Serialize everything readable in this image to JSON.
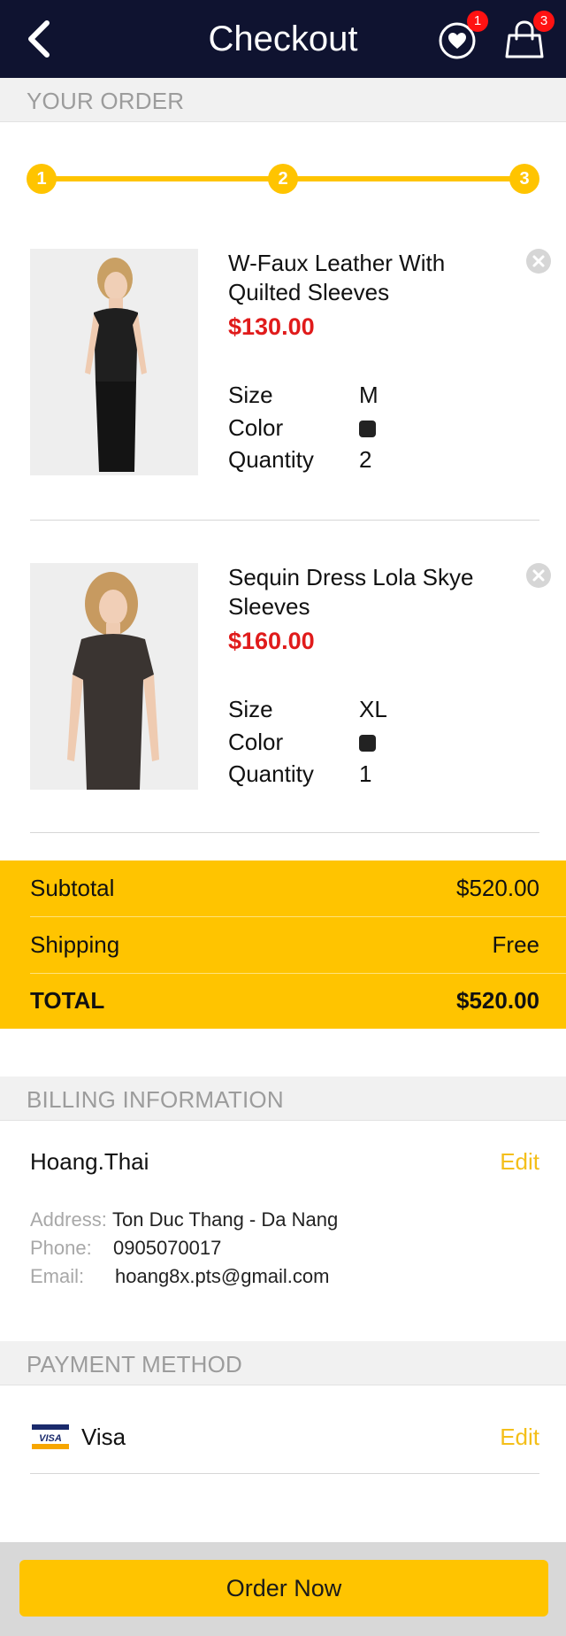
{
  "header": {
    "title": "Checkout",
    "wishlist_count": "1",
    "cart_count": "3"
  },
  "sections": {
    "order": "YOUR ORDER",
    "billing": "BILLING INFORMATION",
    "payment": "PAYMENT METHOD"
  },
  "progress": {
    "steps": [
      "1",
      "2",
      "3"
    ],
    "current_step": 3
  },
  "order_items": [
    {
      "name": "W-Faux Leather With Quilted Sleeves",
      "price": "$130.00",
      "size_label": "Size",
      "size": "M",
      "color_label": "Color",
      "color": "#222222",
      "quantity_label": "Quantity",
      "quantity": "2"
    },
    {
      "name": "Sequin Dress Lola Skye Sleeves",
      "price": "$160.00",
      "size_label": "Size",
      "size": "XL",
      "color_label": "Color",
      "color": "#222222",
      "quantity_label": "Quantity",
      "quantity": "1"
    }
  ],
  "summary": {
    "subtotal_label": "Subtotal",
    "subtotal": "$520.00",
    "shipping_label": "Shipping",
    "shipping": "Free",
    "total_label": "TOTAL",
    "total": "$520.00"
  },
  "billing": {
    "name": "Hoang.Thai",
    "edit_label": "Edit",
    "address_label": "Address:",
    "address": "Ton Duc Thang - Da Nang",
    "phone_label": "Phone:",
    "phone": "0905070017",
    "email_label": "Email:",
    "email": "hoang8x.pts@gmail.com"
  },
  "payment": {
    "method": "Visa",
    "card_brand_text": "VISA",
    "edit_label": "Edit"
  },
  "footer": {
    "order_button": "Order Now"
  },
  "colors": {
    "header_bg": "#0f1330",
    "accent": "#ffc400",
    "price": "#e01b1b",
    "badge": "#ff1212",
    "edit_link": "#f4bf1a"
  },
  "icons": {
    "back": "chevron-left-icon",
    "wishlist": "heart-icon",
    "cart": "shopping-bag-icon",
    "remove": "close-circle-icon",
    "card": "visa-card-icon"
  }
}
